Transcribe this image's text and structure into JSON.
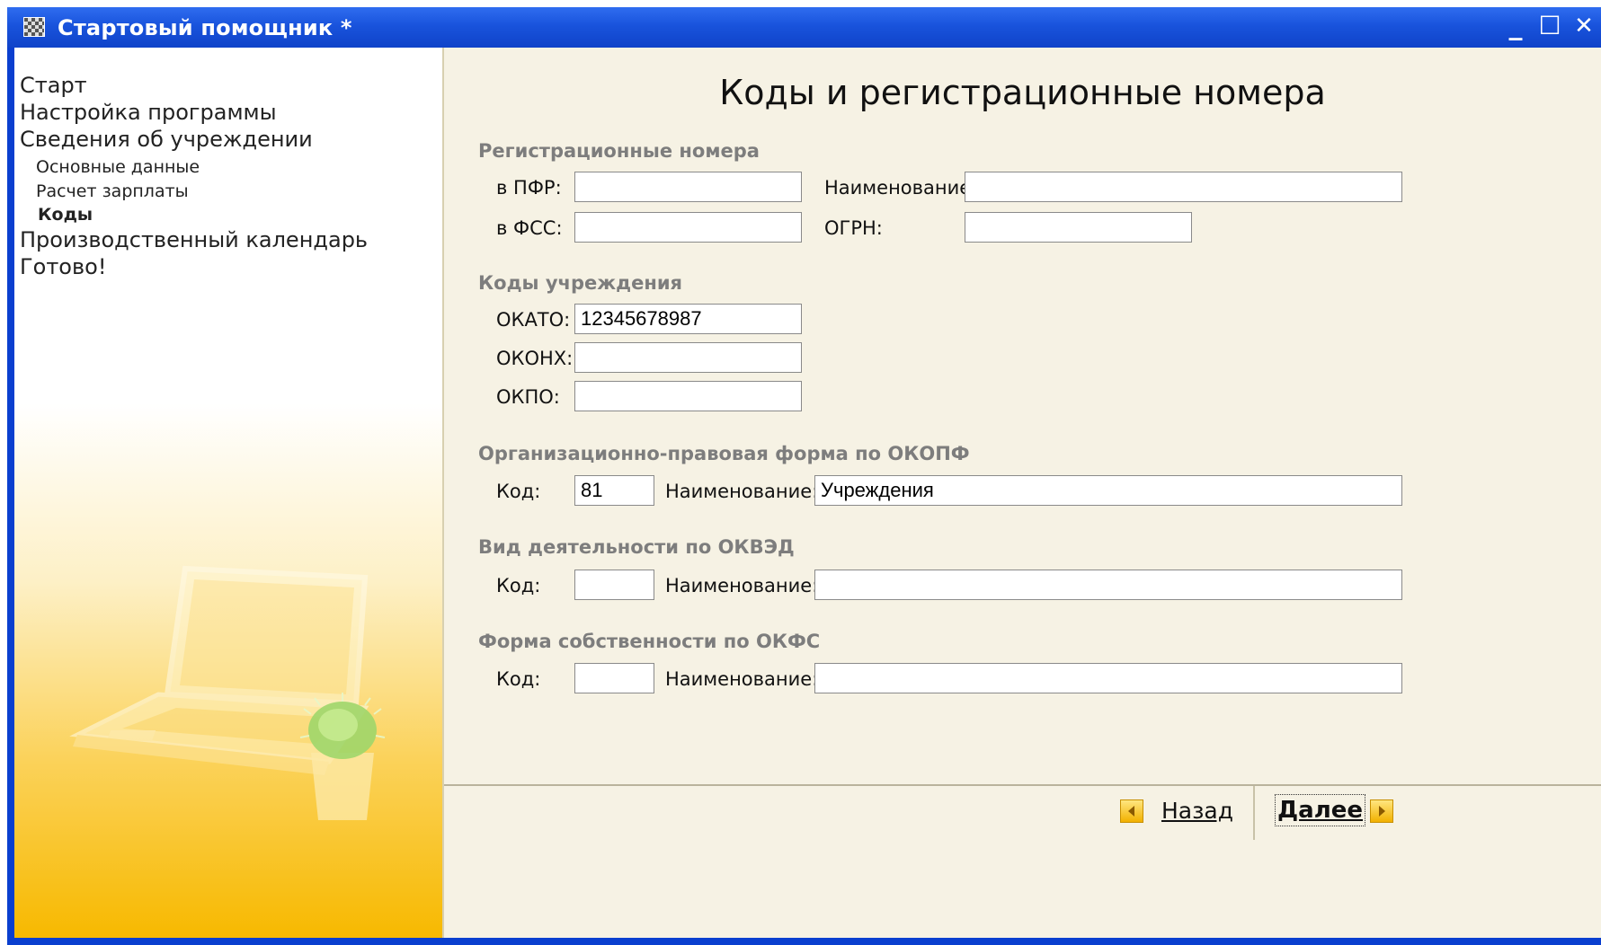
{
  "window": {
    "title": "Стартовый помощник *",
    "controls": {
      "minimize": "_",
      "maximize": "☐",
      "close": "✕"
    }
  },
  "nav": {
    "items": [
      {
        "label": "Старт",
        "level": 0,
        "active": false
      },
      {
        "label": "Настройка программы",
        "level": 0,
        "active": false
      },
      {
        "label": "Сведения об учреждении",
        "level": 0,
        "active": false
      },
      {
        "label": "Основные данные",
        "level": 1,
        "active": false
      },
      {
        "label": "Расчет зарплаты",
        "level": 1,
        "active": false
      },
      {
        "label": "Коды",
        "level": 1,
        "active": true
      },
      {
        "label": "Производственный календарь",
        "level": 0,
        "active": false
      },
      {
        "label": "Готово!",
        "level": 0,
        "active": false
      }
    ]
  },
  "page": {
    "title": "Коды и регистрационные номера",
    "reg": {
      "heading": "Регистрационные номера",
      "pfr_label": "в ПФР:",
      "pfr_value": "",
      "fss_label": "в ФСС:",
      "fss_value": "",
      "name_label": "Наименование:",
      "name_value": "",
      "ogrn_label": "ОГРН:",
      "ogrn_value": ""
    },
    "codes": {
      "heading": "Коды учреждения",
      "okato_label": "ОКАТО:",
      "okato_value": "12345678987",
      "okonh_label": "ОКОНХ:",
      "okonh_value": "",
      "okpo_label": "ОКПО:",
      "okpo_value": ""
    },
    "okopf": {
      "heading": "Организационно-правовая форма по ОКОПФ",
      "code_label": "Код:",
      "code_value": "81",
      "name_label": "Наименование:",
      "name_value": "Учреждения"
    },
    "okved": {
      "heading": "Вид деятельности по ОКВЭД",
      "code_label": "Код:",
      "code_value": "",
      "name_label": "Наименование:",
      "name_value": ""
    },
    "okfs": {
      "heading": "Форма собственности по ОКФС",
      "code_label": "Код:",
      "code_value": "",
      "name_label": "Наименование:",
      "name_value": ""
    }
  },
  "footer": {
    "back_label": "Назад",
    "next_label": "Далее"
  },
  "colors": {
    "titlebar": "#1953dc",
    "section_heading": "#7d7d7d",
    "panel_bg": "#f6f2e4",
    "accent_yellow": "#f7b900"
  }
}
